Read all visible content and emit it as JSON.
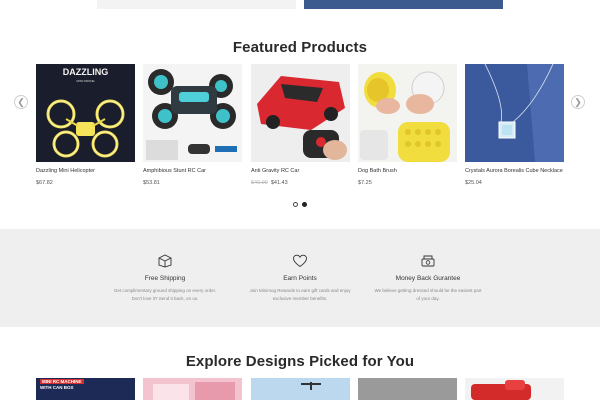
{
  "featured": {
    "title": "Featured Products",
    "products": [
      {
        "name": "Dazzling Mini Helicopter",
        "price": "$67.82",
        "old_price": "",
        "image_text": "DAZZLING",
        "image_subtext": "MINI DRONE"
      },
      {
        "name": "Amphibious Stunt RC Car",
        "price": "$53.81",
        "old_price": ""
      },
      {
        "name": "Anti Gravity RC Car",
        "price": "$41.43",
        "old_price": "$49.99"
      },
      {
        "name": "Dog Bath Brush",
        "price": "$7.25",
        "old_price": ""
      },
      {
        "name": "Crystals Aurora Borealis Cube Necklace",
        "price": "$25.04",
        "old_price": ""
      }
    ],
    "prev_icon": "chevron-left-icon",
    "next_icon": "chevron-right-icon"
  },
  "features": [
    {
      "icon": "box-icon",
      "title": "Free Shipping",
      "desc": "Get complimentary ground shipping on every order. Don't love it? Send it back, on us."
    },
    {
      "icon": "heart-icon",
      "title": "Earn Points",
      "desc": "Join Minimog Rewards to earn gift cards and enjoy exclusive member benefits."
    },
    {
      "icon": "money-icon",
      "title": "Money Back Gurantee",
      "desc": "We believe getting dressed should be the easiest part of your day."
    }
  ],
  "explore": {
    "title": "Explore Designs Picked for You",
    "banner_text_1": "MINI RC MACHINE",
    "banner_text_2": "WITH CAN BOX"
  },
  "colors": {
    "features_bg": "#efefef",
    "title": "#2a2a2a"
  }
}
